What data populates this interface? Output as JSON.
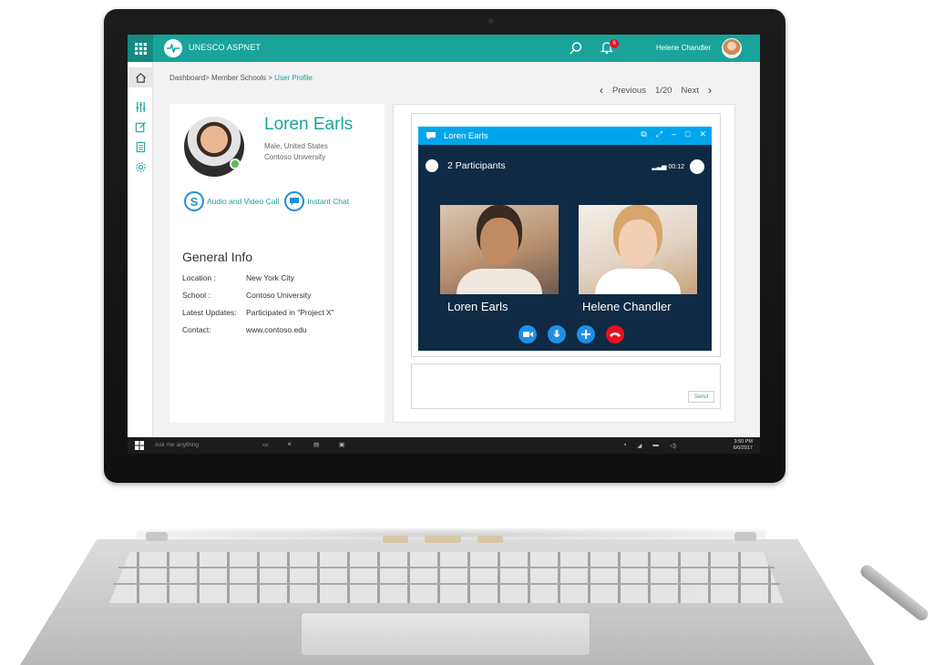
{
  "app": {
    "name": "UNESCO ASPNET",
    "notification_count": "6",
    "user_name": "Helene Chandler"
  },
  "breadcrumb": {
    "path": "Dashboard> Member Schools > ",
    "current": "User Profile"
  },
  "pager": {
    "previous": "Previous",
    "position": "1/20",
    "next": "Next"
  },
  "profile": {
    "name": "Loren Earls",
    "line1": "Male, United States",
    "line2": "Contoso University",
    "actions": {
      "call": "Audio and Video Call",
      "chat": "Instant Chat"
    },
    "general_info_title": "General Info",
    "info": [
      {
        "label": "Location :",
        "value": "New York City"
      },
      {
        "label": "School :",
        "value": "Contoso University"
      },
      {
        "label": "Latest Updates:",
        "value": "Participated in \"Project X\""
      },
      {
        "label": "Contact:",
        "value": "www.contoso.edu"
      }
    ]
  },
  "call": {
    "window_title": "Loren Earls",
    "window_controls": [
      "⧉",
      "⤢",
      "–",
      "□",
      "✕"
    ],
    "participants": "2 Participants",
    "duration": "00:12",
    "tiles": [
      {
        "name": "Loren Earls"
      },
      {
        "name": "Helene Chandler"
      }
    ],
    "send_label": "Send"
  },
  "taskbar": {
    "search_placeholder": "Ask me anything",
    "time": "3:50 PM",
    "date": "6/0/2017"
  },
  "colors": {
    "accent": "#1aa39a",
    "skype_blue": "#00a6ed",
    "call_bg": "#0f2a44",
    "hangup": "#e81123"
  }
}
